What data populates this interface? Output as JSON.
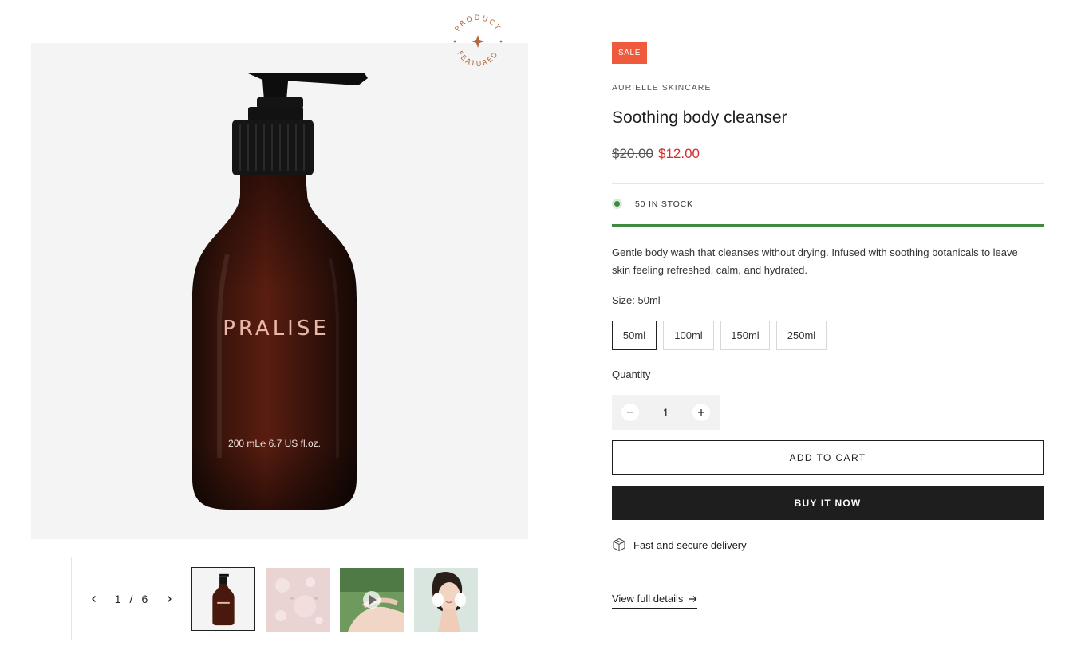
{
  "badge": {
    "sale": "SALE",
    "featured_top": "PRODUCT",
    "featured_bottom": "FEATURED"
  },
  "product": {
    "vendor": "AURIELLE SKINCARE",
    "title": "Soothing body cleanser",
    "price_compare": "$20.00",
    "price_current": "$12.00",
    "stock_text": "50 IN STOCK",
    "stock_level_fraction": 1.0,
    "description": "Gentle body wash that cleanses without drying. Infused with soothing botanicals to leave skin feeling refreshed, calm, and hydrated."
  },
  "bottle": {
    "brand": "PRALISE",
    "volume": "200 mL℮ 6.7 US fl.oz."
  },
  "gallery": {
    "current": "1",
    "separator": "/",
    "total": "6",
    "thumbnails": [
      "product-bottle",
      "gel-texture",
      "video-hands",
      "woman-cleansing"
    ]
  },
  "size": {
    "label": "Size: 50ml",
    "options": [
      "50ml",
      "100ml",
      "150ml",
      "250ml"
    ],
    "selected": "50ml"
  },
  "quantity": {
    "label": "Quantity",
    "value": "1"
  },
  "buttons": {
    "add_to_cart": "ADD TO CART",
    "buy_now": "BUY IT NOW"
  },
  "delivery": {
    "text": "Fast and secure delivery",
    "icon": "box-icon"
  },
  "details_link": "View full details",
  "colors": {
    "sale": "#f05a3c",
    "price": "#d42d2d",
    "stock": "#3f8a43",
    "dark": "#1e1e1e",
    "badge_brown": "#b5653a"
  }
}
